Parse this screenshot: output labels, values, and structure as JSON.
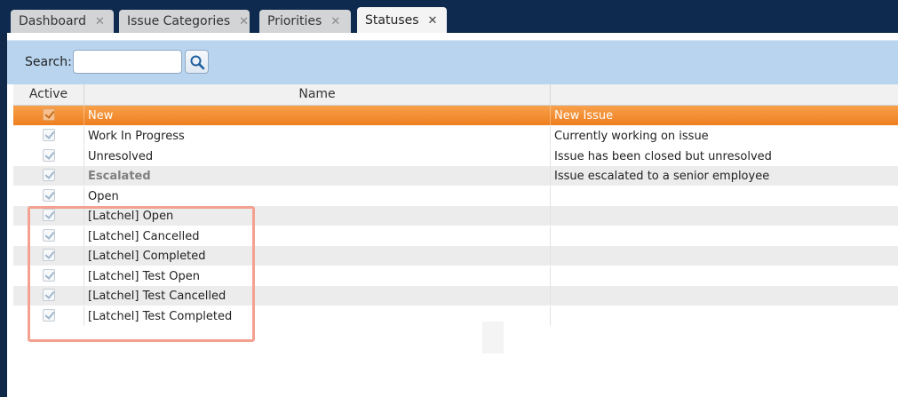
{
  "tabs": [
    {
      "label": "Dashboard",
      "close": "✕",
      "active": false
    },
    {
      "label": "Issue Categories",
      "close": "✕",
      "active": false
    },
    {
      "label": "Priorities",
      "close": "✕",
      "active": false
    },
    {
      "label": "Statuses",
      "close": "✕",
      "active": true
    }
  ],
  "search": {
    "label": "Search:",
    "value": "",
    "placeholder": "",
    "button_icon": "search-icon"
  },
  "grid": {
    "columns": {
      "active": "Active",
      "name": "Name",
      "description": ""
    },
    "rows": [
      {
        "active": true,
        "name": "New",
        "description": "New Issue",
        "selected": true
      },
      {
        "active": true,
        "name": "Work In Progress",
        "description": "Currently working on issue"
      },
      {
        "active": true,
        "name": "Unresolved",
        "description": "Issue has been closed but unresolved"
      },
      {
        "active": true,
        "name": "Escalated",
        "description": "Issue escalated to a senior employee"
      },
      {
        "active": true,
        "name": "Open",
        "description": ""
      },
      {
        "active": true,
        "name": "[Latchel] Open",
        "description": ""
      },
      {
        "active": true,
        "name": "[Latchel] Cancelled",
        "description": ""
      },
      {
        "active": true,
        "name": "[Latchel] Completed",
        "description": ""
      },
      {
        "active": true,
        "name": "[Latchel] Test Open",
        "description": ""
      },
      {
        "active": true,
        "name": "[Latchel] Test Cancelled",
        "description": ""
      },
      {
        "active": true,
        "name": "[Latchel] Test Completed",
        "description": ""
      }
    ]
  },
  "colors": {
    "accent": "#ef7e1e",
    "search_bar": "#b8d4ee",
    "highlight": "#f3a190",
    "tab_bar": "#0e2a4e"
  }
}
